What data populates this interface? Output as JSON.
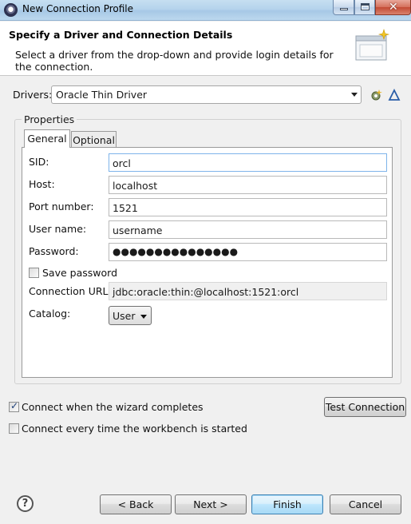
{
  "window": {
    "title": "New Connection Profile"
  },
  "header": {
    "title": "Specify a Driver and Connection Details",
    "description": "Select a driver from the drop-down and provide login details for the connection."
  },
  "drivers": {
    "label": "Drivers:",
    "value": "Oracle Thin Driver"
  },
  "properties": {
    "group_label": "Properties",
    "tabs": [
      {
        "label": "General"
      },
      {
        "label": "Optional"
      }
    ],
    "fields": {
      "sid": {
        "label": "SID:",
        "value": "orcl"
      },
      "host": {
        "label": "Host:",
        "value": "localhost"
      },
      "port": {
        "label": "Port number:",
        "value": "1521"
      },
      "username": {
        "label": "User name:",
        "value": "username"
      },
      "password": {
        "label": "Password:",
        "value": "●●●●●●●●●●●●●●●"
      },
      "save_password": {
        "label": "Save password",
        "checked": false
      },
      "connection_url": {
        "label": "Connection URL:",
        "value": "jdbc:oracle:thin:@localhost:1521:orcl"
      },
      "catalog": {
        "label": "Catalog:",
        "value": "User"
      }
    }
  },
  "options": {
    "connect_on_finish": {
      "label": "Connect when the wizard completes",
      "checked": true
    },
    "connect_on_startup": {
      "label": "Connect every time the workbench is started",
      "checked": false
    },
    "test_connection": "Test Connection"
  },
  "footer": {
    "back": "< Back",
    "next": "Next >",
    "finish": "Finish",
    "cancel": "Cancel",
    "help": "?"
  },
  "icons": {
    "app": "eclipse-icon",
    "banner": "wizard-banner-icon",
    "new_driver": "new-driver-icon",
    "edit_driver": "edit-driver-icon",
    "help": "help-icon"
  }
}
